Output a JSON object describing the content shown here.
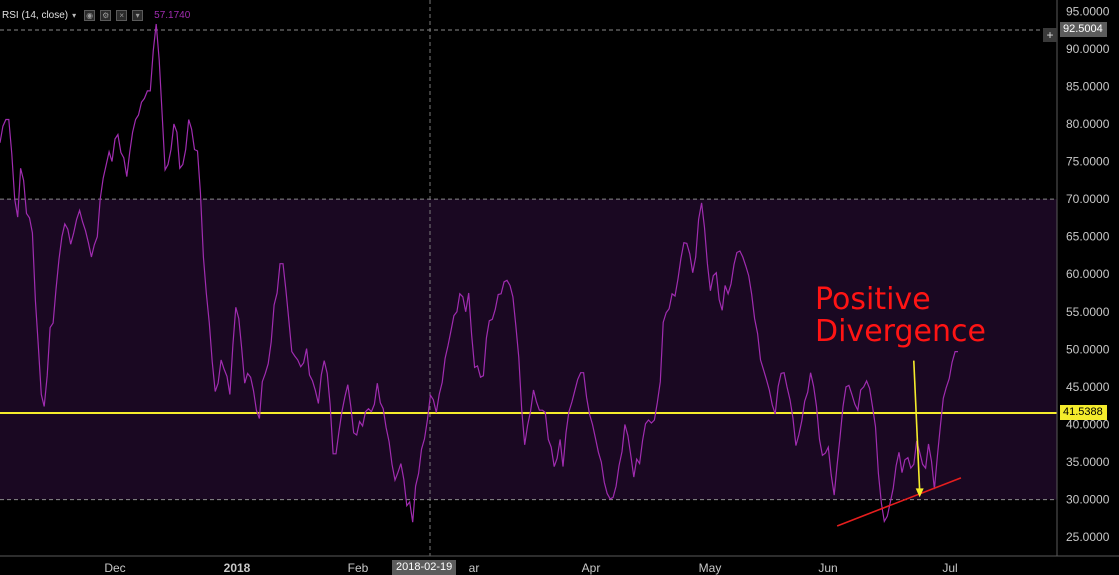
{
  "indicator": {
    "title": "RSI (14, close)",
    "caret": "▾",
    "value": "57.1740",
    "buttons": [
      "eye-icon",
      "settings-icon",
      "close-icon",
      "more-icon"
    ]
  },
  "crosshair": {
    "price_label": "92.5004",
    "date_label": "2018-02-19",
    "plus_label": "+"
  },
  "horizontal_line": {
    "label": "41.5388",
    "color": "#f5ec2c"
  },
  "annotation": {
    "line1": "Positive",
    "line2": "Divergence",
    "color": "#ff1414"
  },
  "colors": {
    "background": "#000000",
    "band_fill": "#1a0822",
    "rsi_line": "#a02cb0",
    "arrow": "#f5ec2c",
    "trendline": "#e61e1e"
  },
  "chart_data": {
    "type": "line",
    "title": "",
    "ylim": [
      22.5,
      96.5
    ],
    "y_ticks": [
      "95.0000",
      "90.0000",
      "85.0000",
      "80.0000",
      "75.0000",
      "70.0000",
      "65.0000",
      "60.0000",
      "55.0000",
      "50.0000",
      "45.0000",
      "40.0000",
      "35.0000",
      "30.0000",
      "25.0000"
    ],
    "x_labels": [
      "Dec",
      "2018",
      "Feb",
      "ar",
      "Apr",
      "May",
      "Jun",
      "Jul"
    ],
    "overbought": 70,
    "oversold": 30,
    "grid": false,
    "series": [
      {
        "values": [
          77.5,
          79.7,
          80.6,
          80.6,
          76.0,
          70.0,
          67.6,
          74.1,
          72.5,
          68.1,
          67.5,
          65.5,
          56.5,
          50.5,
          44.0,
          42.4,
          46.5,
          52.9,
          53.5,
          58.0,
          62.0,
          65.0,
          66.7,
          66.0,
          64.0,
          65.5,
          67.3,
          68.5,
          67.0,
          65.8,
          64.2,
          62.3,
          63.9,
          65.0,
          70.0,
          72.8,
          74.5,
          76.3,
          75.0,
          78.0,
          78.6,
          76.2,
          75.5,
          73.0,
          76.2,
          78.9,
          80.6,
          81.2,
          82.9,
          83.4,
          84.4,
          84.4,
          89.8,
          93.3,
          88.5,
          81.4,
          73.9,
          74.6,
          76.6,
          80.0,
          78.9,
          74.1,
          74.6,
          76.6,
          80.6,
          79.3,
          76.6,
          76.4,
          70.9,
          62.3,
          57.5,
          53.5,
          48.4,
          44.4,
          45.5,
          48.6,
          47.4,
          46.4,
          44.0,
          50.6,
          55.6,
          54.1,
          50.1,
          45.5,
          46.8,
          46.3,
          44.5,
          41.9,
          40.8,
          45.7,
          46.8,
          48.1,
          51.0,
          55.9,
          57.5,
          61.4,
          61.4,
          57.9,
          53.8,
          49.7,
          49.1,
          48.6,
          47.7,
          48.2,
          50.1,
          46.6,
          45.8,
          44.5,
          42.8,
          46.6,
          48.5,
          46.8,
          42.7,
          36.1,
          36.1,
          39.1,
          41.7,
          43.7,
          45.3,
          42.4,
          38.9,
          38.6,
          40.4,
          39.8,
          41.7,
          42.1,
          41.7,
          42.7,
          45.5,
          42.9,
          42.1,
          39.6,
          37.7,
          34.7,
          32.6,
          33.6,
          34.8,
          32.7,
          29.2,
          29.7,
          27.0,
          31.8,
          33.5,
          36.7,
          38.1,
          40.6,
          43.9,
          43.3,
          41.6,
          44.0,
          45.6,
          48.8,
          50.5,
          52.5,
          54.5,
          55.0,
          57.4,
          57.0,
          55.0,
          57.5,
          52.0,
          47.6,
          47.8,
          46.3,
          46.5,
          51.5,
          53.8,
          54.0,
          55.3,
          57.3,
          57.4,
          59.0,
          59.2,
          58.5,
          57.0,
          53.2,
          48.9,
          42.0,
          37.3,
          39.9,
          41.8,
          44.6,
          43.0,
          41.9,
          41.9,
          41.6,
          38.0,
          37.0,
          34.4,
          35.5,
          38.0,
          34.4,
          38.9,
          41.7,
          43.0,
          44.5,
          46.0,
          46.9,
          46.9,
          43.6,
          41.4,
          40.0,
          38.2,
          36.3,
          35.0,
          32.3,
          30.8,
          30.1,
          30.3,
          31.8,
          34.5,
          36.4,
          40.0,
          38.5,
          35.9,
          33.0,
          35.4,
          34.8,
          37.9,
          40.1,
          40.6,
          40.2,
          40.6,
          42.9,
          45.7,
          53.6,
          54.9,
          55.4,
          57.4,
          57.1,
          59.4,
          62.1,
          64.2,
          64.1,
          62.7,
          60.2,
          62.3,
          67.3,
          69.5,
          66.2,
          61.4,
          57.8,
          59.8,
          60.2,
          56.6,
          55.2,
          58.5,
          57.4,
          58.7,
          61.3,
          62.9,
          63.1,
          62.3,
          61.1,
          59.8,
          57.3,
          54.1,
          52.1,
          48.6,
          47.3,
          46.0,
          44.6,
          42.6,
          41.4,
          45.1,
          46.8,
          46.9,
          45.0,
          43.3,
          40.9,
          37.2,
          38.6,
          40.5,
          43.1,
          44.3,
          46.9,
          45.1,
          42.4,
          38.0,
          35.9,
          36.2,
          37.0,
          33.3,
          30.6,
          34.6,
          38.4,
          42.4,
          45.0,
          45.2,
          44.0,
          42.7,
          41.9,
          44.6,
          45.0,
          45.8,
          44.8,
          42.4,
          39.7,
          33.5,
          29.5,
          27.1,
          27.8,
          29.6,
          31.5,
          34.5,
          36.3,
          33.6,
          35.3,
          35.6,
          34.2,
          34.7,
          37.8,
          36.3,
          34.7,
          34.2,
          37.4,
          35.1,
          31.4,
          35.8,
          39.7,
          43.5,
          44.9,
          46.1,
          48.3,
          49.7,
          49.7
        ]
      }
    ],
    "trendline": {
      "from": [
        284,
        26.5
      ],
      "to": [
        326,
        32.9
      ]
    },
    "arrow": {
      "from": [
        310,
        48.5
      ],
      "to": [
        312,
        30.3
      ]
    }
  }
}
